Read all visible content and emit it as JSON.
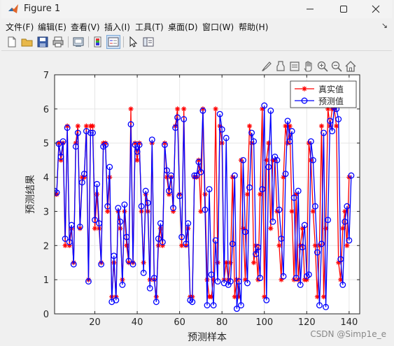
{
  "window": {
    "title": "Figure 1"
  },
  "menu": [
    "文件(F)",
    "编辑(E)",
    "查看(V)",
    "插入(I)",
    "工具(T)",
    "桌面(D)",
    "窗口(W)",
    "帮助(H)"
  ],
  "toolbar_icons": [
    "new-figure-icon",
    "open-file-icon",
    "save-icon",
    "print-icon",
    "link-plot-icon",
    "colorbar-icon",
    "legend-icon",
    "pointer-icon",
    "property-editor-icon"
  ],
  "axes_toolbar_icons": [
    "brush-icon",
    "data-tips-icon",
    "export-icon",
    "pan-icon",
    "zoom-in-icon",
    "zoom-out-icon",
    "home-icon"
  ],
  "watermark": "CSDN @Simp1e_e",
  "colors": {
    "true_series": "#ff0000",
    "pred_series": "#0000ff",
    "axes_bg": "#ffffff",
    "window_bg": "#f0f0f0"
  },
  "chart_data": {
    "type": "line",
    "xlabel": "预测样本",
    "ylabel": "预测结果",
    "xlim": [
      1,
      145
    ],
    "ylim": [
      0,
      7
    ],
    "xticks": [
      20,
      40,
      60,
      80,
      100,
      120,
      140
    ],
    "yticks": [
      0,
      1,
      2,
      3,
      4,
      5,
      6,
      7
    ],
    "grid": true,
    "legend_position": "top-right",
    "series": [
      {
        "name": "真实值",
        "marker": "star",
        "color": "#ff0000",
        "values": [
          3.5,
          3.5,
          5,
          4.5,
          5,
          2,
          5.5,
          2,
          2.5,
          1.5,
          5,
          5.5,
          2.5,
          4,
          4,
          5.5,
          1,
          5.5,
          5.5,
          2.5,
          3.5,
          2.5,
          1.5,
          5,
          5,
          3,
          4,
          0.5,
          1.5,
          0.5,
          3,
          2.5,
          1,
          3,
          2,
          1.5,
          6,
          1.5,
          5,
          4.5,
          5,
          3,
          1.5,
          3.5,
          3,
          1,
          5,
          1,
          0.5,
          2,
          2.5,
          2,
          5,
          4,
          3.5,
          4,
          3,
          5.5,
          6,
          3.5,
          2,
          6,
          2,
          2.5,
          0.5,
          0.5,
          4,
          4,
          4.5,
          3,
          6,
          3.5,
          1,
          0.5,
          0.5,
          1,
          6,
          1.5,
          5.5,
          5,
          1,
          1.5,
          1,
          1.5,
          4,
          0.5,
          1,
          0.5,
          4.5,
          2.5,
          1,
          3.5,
          5.5,
          5,
          1.5,
          2,
          1,
          3.5,
          6,
          0.5,
          4.5,
          5,
          2.5,
          4.5,
          4.5,
          3,
          2,
          1,
          4,
          5.5,
          5,
          5.5,
          3,
          1,
          3.5,
          1,
          2,
          2.5,
          1,
          1,
          5,
          4.5,
          3,
          2,
          0.5,
          2,
          5.5,
          0.5,
          2.5,
          6,
          5.5,
          6,
          6,
          5.5,
          1.5,
          1,
          2.5,
          3,
          2,
          4
        ],
        "note": "values"
      },
      {
        "name": "预测值",
        "marker": "circle",
        "color": "#0000ff",
        "values": [
          3.6,
          3.55,
          4.98,
          4.6,
          5.05,
          2.2,
          5.45,
          2.1,
          2.6,
          1.45,
          4.9,
          5.3,
          2.55,
          3.85,
          4.1,
          5.35,
          0.95,
          5.3,
          5.3,
          2.75,
          3.8,
          2.65,
          1.45,
          4.9,
          4.95,
          3.15,
          4.3,
          0.35,
          1.7,
          0.4,
          3.1,
          2.7,
          0.85,
          3.2,
          2.25,
          1.55,
          5.55,
          1.45,
          4.95,
          4.75,
          4.95,
          3.15,
          1.2,
          3.6,
          3.25,
          0.75,
          5.1,
          1.05,
          0.35,
          2.2,
          2.65,
          2.1,
          4.95,
          4.2,
          3.6,
          4.05,
          3.1,
          5.45,
          5.75,
          3.45,
          2.25,
          5.7,
          2.05,
          2.65,
          0.4,
          0.35,
          4.05,
          4.05,
          4.45,
          4.15,
          5.95,
          3.05,
          0.25,
          3.65,
          1.15,
          0.25,
          2.15,
          0.95,
          5.85,
          5.4,
          0.9,
          5.15,
          0.85,
          0.95,
          2.05,
          4.05,
          0.15,
          0.95,
          0.25,
          4.5,
          2.4,
          0.9,
          3.7,
          5.3,
          5.05,
          1.75,
          1.95,
          1.05,
          3.65,
          6.1,
          0.4,
          4.3,
          5.95,
          2.7,
          4.6,
          4.5,
          3.05,
          2.2,
          1.1,
          4.1,
          5.65,
          5.05,
          5.35,
          3.4,
          1.05,
          3.6,
          0.85,
          1.95,
          2.6,
          1.1,
          1.15,
          5.05,
          4.5,
          3.15,
          1.8,
          0.25,
          2.05,
          5.3,
          0.2,
          2.75,
          5.65,
          5.35,
          6.05,
          6.0,
          5.7,
          1.6,
          0.85,
          2.7,
          3.15,
          2.15,
          4.05
        ]
      }
    ]
  }
}
